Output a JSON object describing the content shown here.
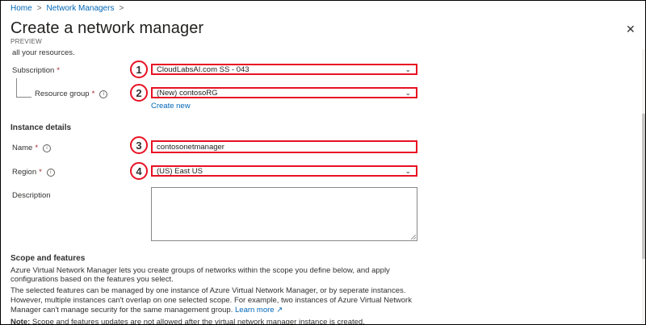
{
  "breadcrumb": {
    "items": [
      "Home",
      "Network Managers"
    ],
    "separator": ">"
  },
  "header": {
    "title": "Create a network manager",
    "more": "···",
    "subtitle": "PREVIEW",
    "close": "✕"
  },
  "partial_text": "all your resources.",
  "form": {
    "subscription": {
      "label": "Subscription",
      "required": "*",
      "value": "CloudLabsAI.com SS - 043",
      "marker": "1"
    },
    "resource_group": {
      "label": "Resource group",
      "required": "*",
      "value": "(New) contosoRG",
      "marker": "2",
      "create_new": "Create new"
    },
    "instance_heading": "Instance details",
    "name": {
      "label": "Name",
      "required": "*",
      "value": "contosonetmanager",
      "marker": "3"
    },
    "region": {
      "label": "Region",
      "required": "*",
      "value": "(US) East US",
      "marker": "4"
    },
    "description": {
      "label": "Description",
      "value": ""
    }
  },
  "scope": {
    "heading": "Scope and features",
    "line1": "Azure Virtual Network Manager lets you create groups of networks within the scope you define below, and apply",
    "line2": "configurations based on the features you select.",
    "line3": "The selected features can be managed by one instance of Azure Virtual Network Manager, or by seperate instances.",
    "line4": "However, multiple instances can't overlap on one selected scope. For example, two instances of Azure Virtual Network",
    "line5": "Manager can't manage security for the same management group.",
    "learn_more": "Learn more",
    "note_label": "Note:",
    "note_text": "Scope and features updates are not allowed after the virtual network manager instance is created."
  },
  "icons": {
    "info": "i",
    "chevron": "⌄",
    "external": "↗"
  },
  "colors": {
    "highlight": "#e81123",
    "link": "#0067b8"
  }
}
